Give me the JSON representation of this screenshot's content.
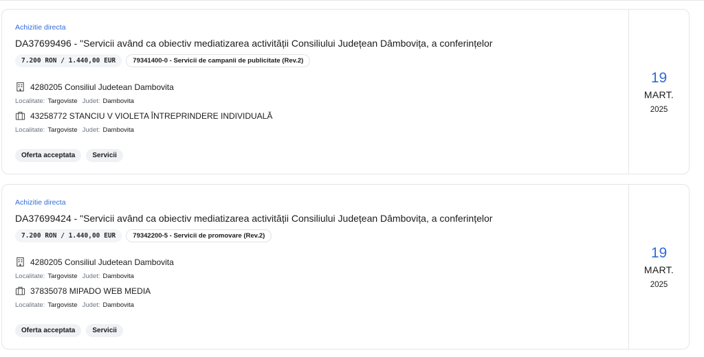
{
  "colors": {
    "accent": "#2f6bd8",
    "border": "#e3e5e8",
    "chip_bg": "#f2f4f7"
  },
  "cards": [
    {
      "type_label": "Achizitie directa",
      "title": "DA37699496 - \"Servicii având ca obiectiv mediatizarea activității Consiliului Județean Dâmbovița, a conferințelor",
      "value": "7.200 RON / 1.440,00 EUR",
      "cpv": "79341400-0 - Servicii de campanii de publicitate (Rev.2)",
      "authority": {
        "icon": "building-icon",
        "name": "4280205 Consiliul Judetean Dambovita",
        "localitate_key": "Localitate:",
        "localitate_val": "Targoviste",
        "judet_key": "Judet:",
        "judet_val": "Dambovita"
      },
      "supplier": {
        "icon": "briefcase-icon",
        "name": "43258772 STANCIU V VIOLETA ÎNTREPRINDERE INDIVIDUALĂ",
        "localitate_key": "Localitate:",
        "localitate_val": "Targoviste",
        "judet_key": "Judet:",
        "judet_val": "Dambovita"
      },
      "tags": [
        "Oferta acceptata",
        "Servicii"
      ],
      "date": {
        "day": "19",
        "month": "MART.",
        "year": "2025"
      }
    },
    {
      "type_label": "Achizitie directa",
      "title": "DA37699424 - \"Servicii având ca obiectiv mediatizarea activității Consiliului Județean Dâmbovița, a conferințelor",
      "value": "7.200 RON / 1.440,00 EUR",
      "cpv": "79342200-5 - Servicii de promovare (Rev.2)",
      "authority": {
        "icon": "building-icon",
        "name": "4280205 Consiliul Judetean Dambovita",
        "localitate_key": "Localitate:",
        "localitate_val": "Targoviste",
        "judet_key": "Judet:",
        "judet_val": "Dambovita"
      },
      "supplier": {
        "icon": "briefcase-icon",
        "name": "37835078 MIPADO WEB MEDIA",
        "localitate_key": "Localitate:",
        "localitate_val": "Targoviste",
        "judet_key": "Judet:",
        "judet_val": "Dambovita"
      },
      "tags": [
        "Oferta acceptata",
        "Servicii"
      ],
      "date": {
        "day": "19",
        "month": "MART.",
        "year": "2025"
      }
    }
  ]
}
